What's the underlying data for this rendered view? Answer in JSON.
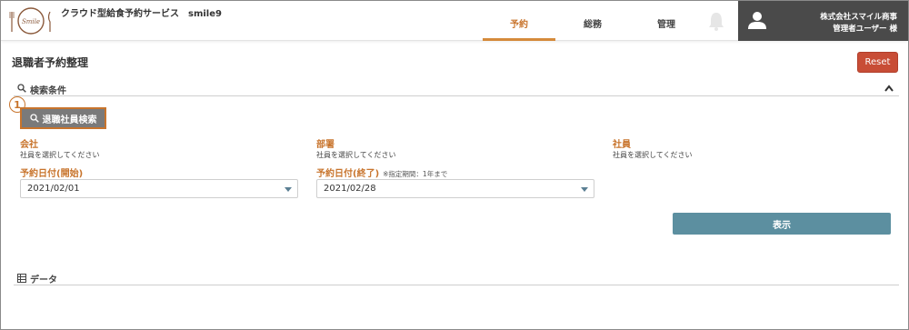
{
  "header": {
    "logo_text": "Smile",
    "service_title": "クラウド型給食予約サービス　smile9",
    "nav": [
      {
        "label": "予約",
        "active": true
      },
      {
        "label": "総務",
        "active": false
      },
      {
        "label": "管理",
        "active": false
      }
    ],
    "bell_icon": "bell-icon",
    "user": {
      "avatar_icon": "user-icon",
      "company": "株式会社スマイル商事",
      "name": "管理者ユーザー 様"
    }
  },
  "page": {
    "title": "退職者予約整理",
    "reset_label": "Reset"
  },
  "search": {
    "section_label": "検索条件",
    "step_number": "1",
    "retiree_button_label": "退職社員検索",
    "company": {
      "label": "会社",
      "value": "社員を選択してください"
    },
    "department": {
      "label": "部署",
      "value": "社員を選択してください"
    },
    "employee": {
      "label": "社員",
      "value": "社員を選択してください"
    },
    "date_start": {
      "label": "予約日付(開始)",
      "value": "2021/02/01"
    },
    "date_end": {
      "label": "予約日付(終了)",
      "note": "※指定期間：1年まで",
      "value": "2021/02/28"
    },
    "show_label": "表示"
  },
  "data_section": {
    "label": "データ"
  },
  "colors": {
    "accent": "#c8742c",
    "reset": "#c84d36",
    "show_button": "#5c8fa0",
    "user_box": "#4a4a4a"
  }
}
